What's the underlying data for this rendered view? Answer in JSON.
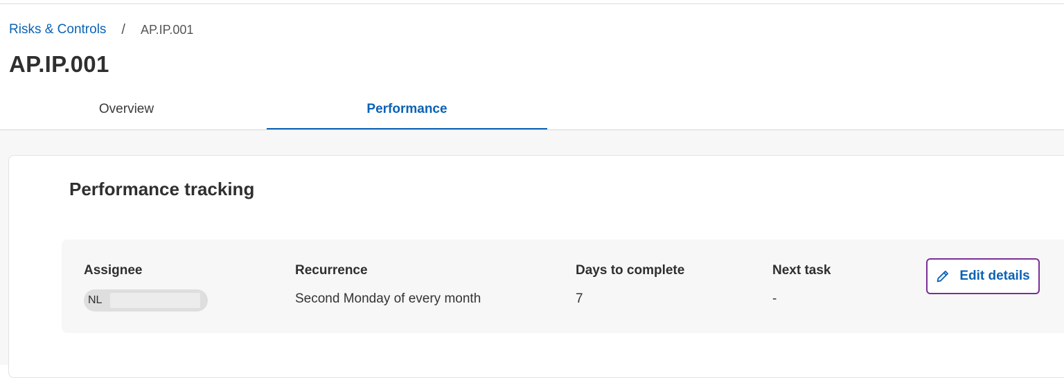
{
  "breadcrumb": {
    "parent": "Risks & Controls",
    "separator": "/",
    "current": "AP.IP.001"
  },
  "page": {
    "title": "AP.IP.001"
  },
  "tabs": [
    {
      "label": "Overview",
      "active": false
    },
    {
      "label": "Performance",
      "active": true
    }
  ],
  "performance": {
    "section_title": "Performance tracking",
    "fields": {
      "assignee_label": "Assignee",
      "assignee_initials": "NL",
      "recurrence_label": "Recurrence",
      "recurrence_value": "Second Monday of every month",
      "days_label": "Days to complete",
      "days_value": "7",
      "next_task_label": "Next task",
      "next_task_value": "-"
    },
    "edit_label": "Edit details"
  },
  "colors": {
    "link": "#0b62b5",
    "focus_ring": "#7a2e96",
    "text": "#2f2f2f"
  },
  "icons": {
    "edit": "pencil-icon"
  }
}
